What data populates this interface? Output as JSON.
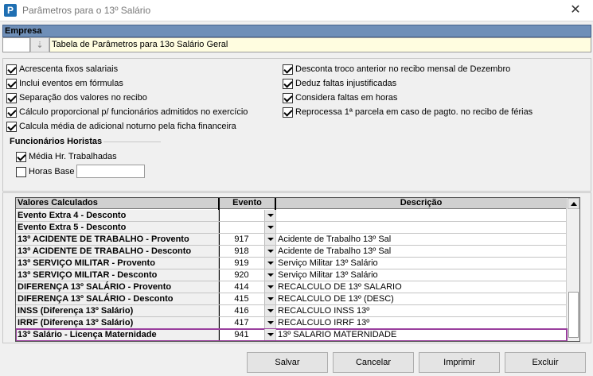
{
  "window": {
    "title": "Parâmetros para o 13º Salário",
    "app_icon": "P"
  },
  "empresa": {
    "header": "Empresa",
    "code": "",
    "name": "Tabela de Parâmetros para 13o Salário Geral"
  },
  "options": {
    "left": [
      {
        "label": "Acrescenta fixos salariais",
        "checked": true
      },
      {
        "label": "Inclui eventos em fórmulas",
        "checked": true
      },
      {
        "label": "Separação dos valores no recibo",
        "checked": true
      },
      {
        "label": "Cálculo proporcional p/ funcionários admitidos no exercício",
        "checked": true
      },
      {
        "label": "Calcula média de adicional noturno pela ficha financeira",
        "checked": true
      }
    ],
    "right": [
      {
        "label": "Desconta troco anterior no recibo mensal de Dezembro",
        "checked": true
      },
      {
        "label": "Deduz faltas injustificadas",
        "checked": true
      },
      {
        "label": "Considera faltas em horas",
        "checked": true
      },
      {
        "label": "Reprocessa 1ª parcela em caso de pagto. no recibo de férias",
        "checked": true
      }
    ]
  },
  "horistas": {
    "title": "Funcionários Horistas",
    "media_label": "Média Hr. Trabalhadas",
    "media_checked": true,
    "horas_label": "Horas Base",
    "horas_checked": false,
    "horas_value": ""
  },
  "grid": {
    "headers": [
      "Valores Calculados",
      "Evento",
      "Descrição"
    ],
    "rows": [
      {
        "name": "Evento Extra 4 - Desconto",
        "evento": "",
        "descricao": ""
      },
      {
        "name": "Evento Extra 5 - Desconto",
        "evento": "",
        "descricao": ""
      },
      {
        "name": "13º ACIDENTE DE TRABALHO - Provento",
        "evento": "917",
        "descricao": "Acidente de Trabalho 13º Sal"
      },
      {
        "name": "13º ACIDENTE DE TRABALHO - Desconto",
        "evento": "918",
        "descricao": "Acidente de Trabalho 13º Sal"
      },
      {
        "name": "13º SERVIÇO MILITAR - Provento",
        "evento": "919",
        "descricao": "Serviço Militar 13º Salário"
      },
      {
        "name": "13º SERVIÇO MILITAR - Desconto",
        "evento": "920",
        "descricao": "Serviço Militar 13º Salário"
      },
      {
        "name": "DIFERENÇA 13º SALÁRIO - Provento",
        "evento": "414",
        "descricao": "RECALCULO DE 13º SALARIO"
      },
      {
        "name": "DIFERENÇA 13º SALÁRIO - Desconto",
        "evento": "415",
        "descricao": "RECALCULO DE 13º (DESC)"
      },
      {
        "name": "INSS (Diferença 13º Salário)",
        "evento": "416",
        "descricao": "RECALCULO  INSS 13º"
      },
      {
        "name": "IRRF (Diferença 13º Salário)",
        "evento": "417",
        "descricao": "RECALCULO IRRF 13º"
      },
      {
        "name": "13º Salário - Licença Maternidade",
        "evento": "941",
        "descricao": "13º SALARIO MATERNIDADE",
        "selected": true
      }
    ]
  },
  "buttons": {
    "salvar": "Salvar",
    "cancelar": "Cancelar",
    "imprimir": "Imprimir",
    "excluir": "Excluir"
  },
  "colors": {
    "header_blue": "#6f8fb8",
    "selection": "#9a3f9e",
    "empresa_name_bg": "#fffde0"
  }
}
